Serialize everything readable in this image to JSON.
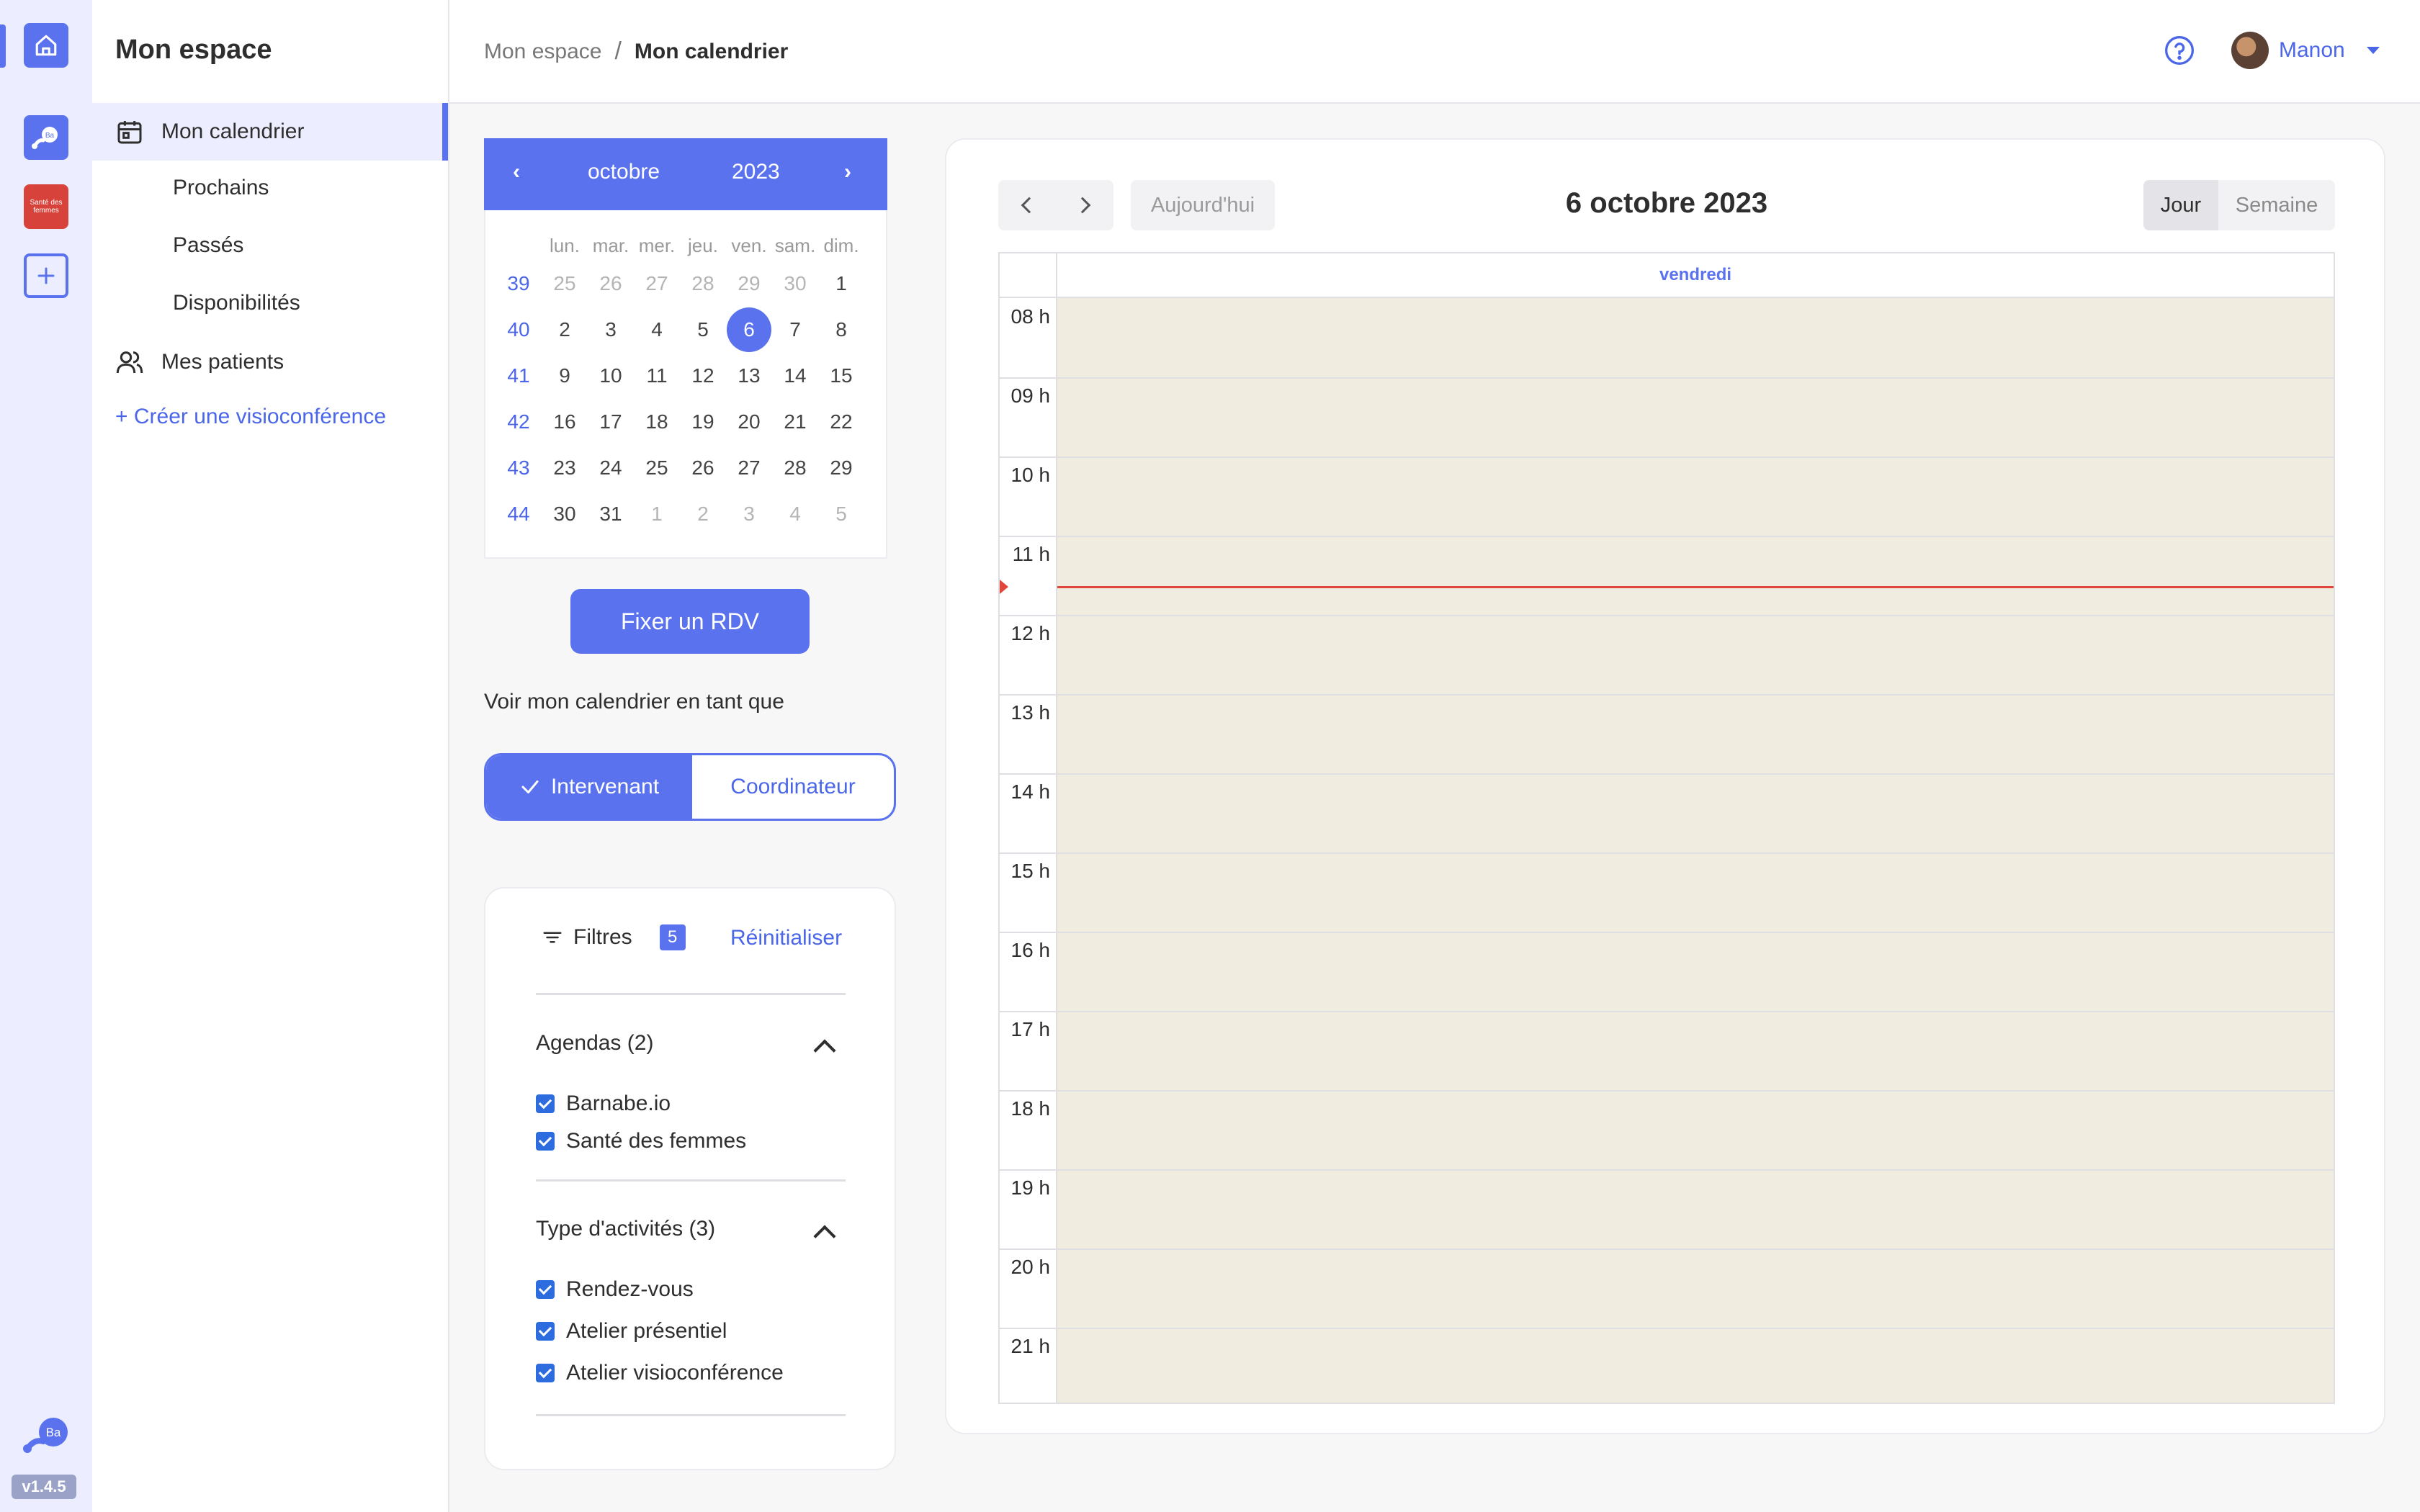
{
  "app": {
    "version": "v1.4.5",
    "rail": {
      "home_icon": "home-icon",
      "barnabe_badge": "Ba",
      "sante_badge": "Santé des femmes",
      "add_icon": "plus-icon"
    },
    "accent_color": "#5b72ee"
  },
  "nav": {
    "title": "Mon espace",
    "items": [
      {
        "label": "Mon calendrier",
        "icon": "calendar-icon",
        "active": true
      },
      {
        "label": "Prochains"
      },
      {
        "label": "Passés"
      },
      {
        "label": "Disponibilités"
      },
      {
        "label": "Mes patients",
        "icon": "users-icon"
      }
    ],
    "create_link": "+ Créer une visioconférence"
  },
  "header": {
    "breadcrumb": [
      "Mon espace",
      "/",
      "Mon calendrier"
    ],
    "help_icon": "help-circle-icon",
    "user_name": "Manon"
  },
  "mini_calendar": {
    "month": "octobre",
    "year": "2023",
    "prev": "‹",
    "next": "›",
    "weekdays": [
      "lun.",
      "mar.",
      "mer.",
      "jeu.",
      "ven.",
      "sam.",
      "dim."
    ],
    "weeks": [
      {
        "num": "39",
        "days": [
          "25",
          "26",
          "27",
          "28",
          "29",
          "30",
          "1"
        ],
        "out": [
          1,
          1,
          1,
          1,
          1,
          1,
          0
        ]
      },
      {
        "num": "40",
        "days": [
          "2",
          "3",
          "4",
          "5",
          "6",
          "7",
          "8"
        ],
        "out": [
          0,
          0,
          0,
          0,
          0,
          0,
          0
        ]
      },
      {
        "num": "41",
        "days": [
          "9",
          "10",
          "11",
          "12",
          "13",
          "14",
          "15"
        ],
        "out": [
          0,
          0,
          0,
          0,
          0,
          0,
          0
        ]
      },
      {
        "num": "42",
        "days": [
          "16",
          "17",
          "18",
          "19",
          "20",
          "21",
          "22"
        ],
        "out": [
          0,
          0,
          0,
          0,
          0,
          0,
          0
        ]
      },
      {
        "num": "43",
        "days": [
          "23",
          "24",
          "25",
          "26",
          "27",
          "28",
          "29"
        ],
        "out": [
          0,
          0,
          0,
          0,
          0,
          0,
          0
        ]
      },
      {
        "num": "44",
        "days": [
          "30",
          "31",
          "1",
          "2",
          "3",
          "4",
          "5"
        ],
        "out": [
          0,
          0,
          1,
          1,
          1,
          1,
          1
        ]
      }
    ],
    "selected_day": "6"
  },
  "actions": {
    "fix_rdv": "Fixer un RDV",
    "view_as_label": "Voir mon calendrier en tant que",
    "roles": [
      "Intervenant",
      "Coordinateur"
    ],
    "selected_role": "Intervenant"
  },
  "filters": {
    "title": "Filtres",
    "count": "5",
    "reset": "Réinitialiser",
    "sections": [
      {
        "title": "Agendas (2)",
        "options": [
          "Barnabe.io",
          "Santé des femmes"
        ]
      },
      {
        "title": "Type d'activités (3)",
        "options": [
          "Rendez-vous",
          "Atelier présentiel",
          "Atelier visioconférence"
        ]
      }
    ]
  },
  "calendar": {
    "today_button": "Aujourd'hui",
    "title": "6 octobre 2023",
    "views": [
      "Jour",
      "Semaine"
    ],
    "active_view": "Jour",
    "day_name": "vendredi",
    "hours": [
      "08 h",
      "09 h",
      "10 h",
      "11 h",
      "12 h",
      "13 h",
      "14 h",
      "15 h",
      "16 h",
      "17 h",
      "18 h",
      "19 h",
      "20 h",
      "21 h"
    ],
    "now_color": "#e0463b",
    "day_background": "#f0ede0"
  }
}
